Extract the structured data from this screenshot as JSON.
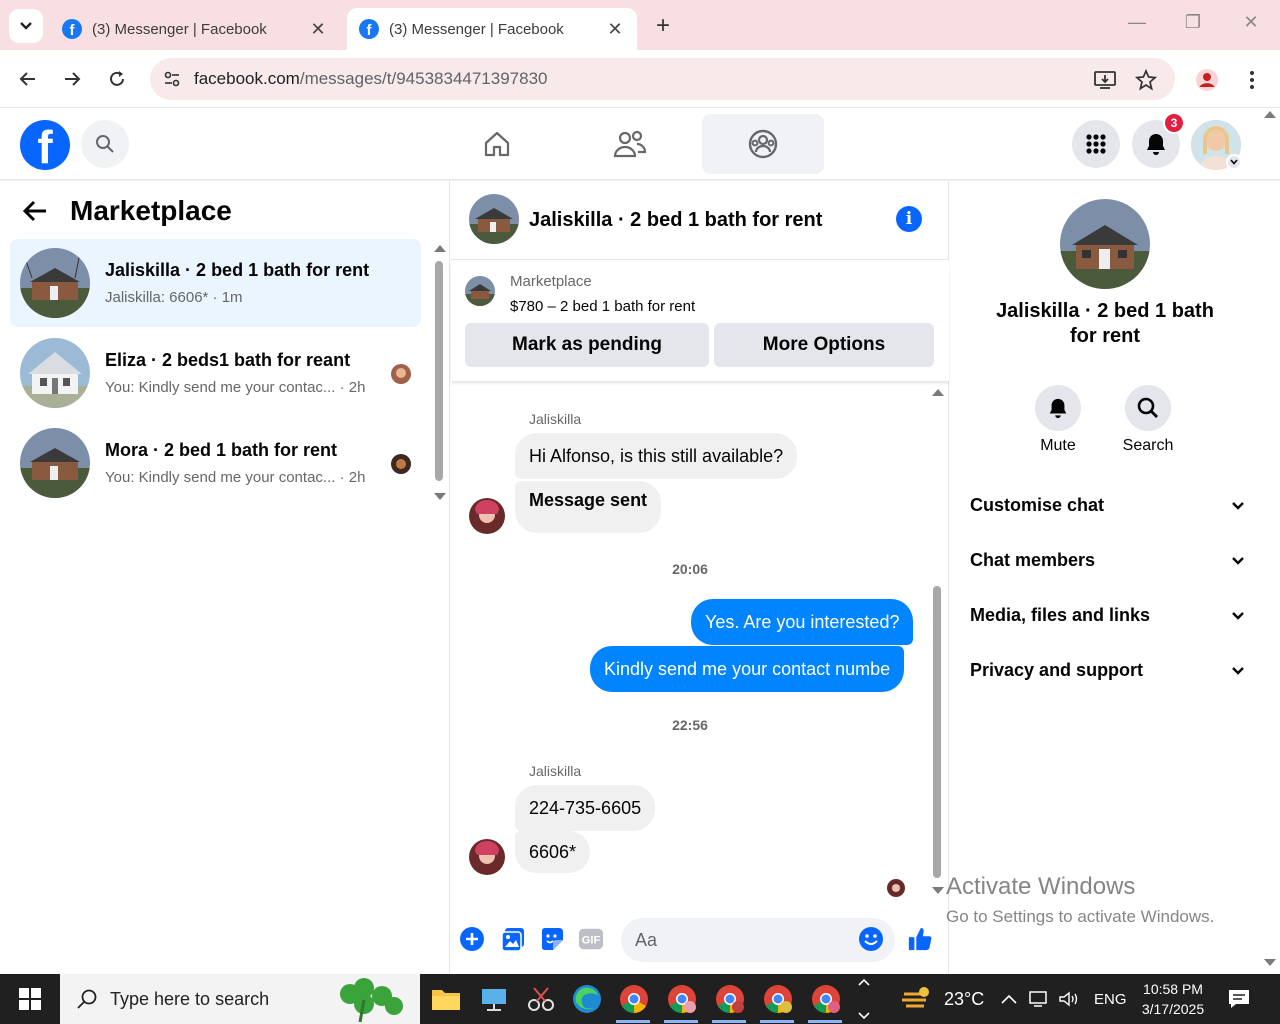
{
  "browser": {
    "tabs": [
      {
        "title": "(3) Messenger | Facebook",
        "active": false
      },
      {
        "title": "(3) Messenger | Facebook",
        "active": true
      }
    ],
    "url_host": "facebook.com",
    "url_path": "/messages/t/9453834471397830"
  },
  "fb": {
    "notification_count": "3"
  },
  "left": {
    "title": "Marketplace",
    "conversations": [
      {
        "name": "Jaliskilla · 2 bed 1 bath for rent",
        "preview": "Jaliskilla: 6606* · 1m",
        "selected": true
      },
      {
        "name": "Eliza · 2 beds1 bath for reant",
        "preview": "You: Kindly send me your contac... · 2h",
        "selected": false
      },
      {
        "name": "Mora · 2 bed 1 bath for rent",
        "preview": "You: Kindly send me your contac... · 2h",
        "selected": false
      }
    ]
  },
  "chat": {
    "title": "Jaliskilla · 2 bed 1 bath for rent",
    "listing_label": "Marketplace",
    "listing_price": "$780 – 2 bed 1 bath for rent",
    "mark_pending": "Mark as pending",
    "more_options": "More Options",
    "sender1": "Jaliskilla",
    "msg1": "Hi Alfonso, is this still available?",
    "msg2": "Message sent",
    "time1": "20:06",
    "msg3": "Yes. Are you interested?",
    "msg4": "Kindly send me your contact numbe",
    "time2": "22:56",
    "sender2": "Jaliskilla",
    "msg5": "224-735-6605",
    "msg6": "6606*",
    "composer_placeholder": "Aa"
  },
  "right": {
    "title": "Jaliskilla · 2 bed 1 bath for rent",
    "mute": "Mute",
    "search": "Search",
    "sections": [
      "Customise chat",
      "Chat members",
      "Media, files and links",
      "Privacy and support"
    ]
  },
  "watermark": {
    "line1": "Activate Windows",
    "line2": "Go to Settings to activate Windows."
  },
  "taskbar": {
    "search_placeholder": "Type here to search",
    "temperature": "23°C",
    "language": "ENG",
    "time": "10:58 PM",
    "date": "3/17/2025"
  },
  "colors": {
    "fb_blue": "#0866ff",
    "outgoing_bubble": "#0084ff",
    "tabbar": "#f8dfe1"
  }
}
